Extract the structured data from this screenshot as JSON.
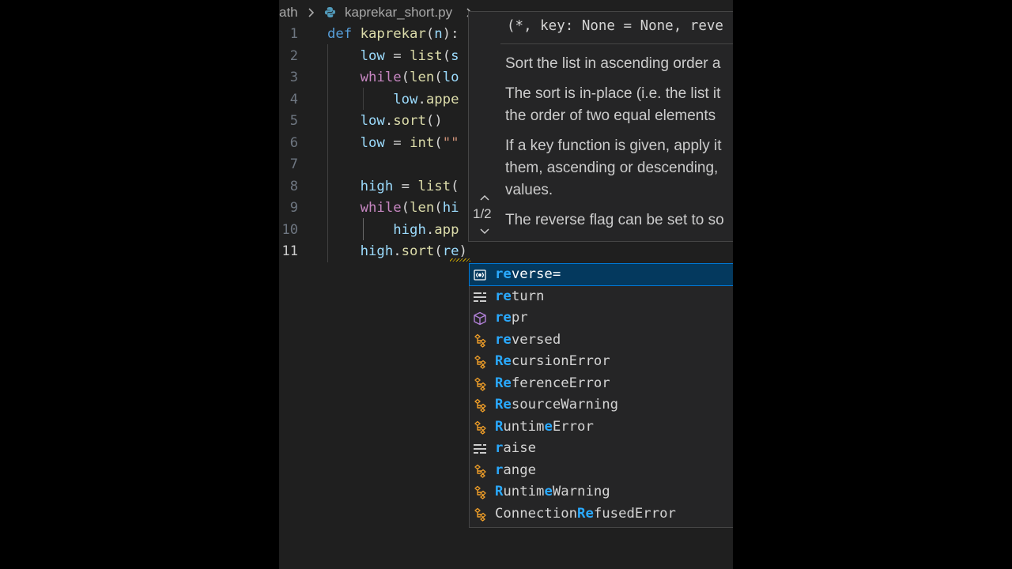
{
  "breadcrumb": {
    "folder": "ath",
    "file": "kaprekar_short.py"
  },
  "code_lines": [
    {
      "num": "1",
      "indent": "",
      "parts": [
        [
          "kw-def",
          "def "
        ],
        [
          "fn",
          "kaprekar"
        ],
        [
          "tx",
          "("
        ],
        [
          "var",
          "n"
        ],
        [
          "tx",
          "):"
        ]
      ]
    },
    {
      "num": "2",
      "indent": "    ",
      "parts": [
        [
          "var",
          "low"
        ],
        [
          "tx",
          " = "
        ],
        [
          "fn",
          "list"
        ],
        [
          "tx",
          "("
        ],
        [
          "var",
          "s"
        ]
      ]
    },
    {
      "num": "3",
      "indent": "    ",
      "parts": [
        [
          "kw-ctrl",
          "while"
        ],
        [
          "tx",
          "("
        ],
        [
          "fn",
          "len"
        ],
        [
          "tx",
          "("
        ],
        [
          "var",
          "lo"
        ]
      ]
    },
    {
      "num": "4",
      "indent": "        ",
      "parts": [
        [
          "var",
          "low"
        ],
        [
          "tx",
          "."
        ],
        [
          "fn",
          "appe"
        ]
      ]
    },
    {
      "num": "5",
      "indent": "    ",
      "parts": [
        [
          "var",
          "low"
        ],
        [
          "tx",
          "."
        ],
        [
          "fn",
          "sort"
        ],
        [
          "tx",
          "()"
        ]
      ]
    },
    {
      "num": "6",
      "indent": "    ",
      "parts": [
        [
          "var",
          "low"
        ],
        [
          "tx",
          " = "
        ],
        [
          "fn",
          "int"
        ],
        [
          "tx",
          "("
        ],
        [
          "str",
          "\"\""
        ]
      ]
    },
    {
      "num": "7",
      "indent": "",
      "parts": []
    },
    {
      "num": "8",
      "indent": "    ",
      "parts": [
        [
          "var",
          "high"
        ],
        [
          "tx",
          " = "
        ],
        [
          "fn",
          "list"
        ],
        [
          "tx",
          "("
        ]
      ]
    },
    {
      "num": "9",
      "indent": "    ",
      "parts": [
        [
          "kw-ctrl",
          "while"
        ],
        [
          "tx",
          "("
        ],
        [
          "fn",
          "len"
        ],
        [
          "tx",
          "("
        ],
        [
          "var",
          "hi"
        ]
      ]
    },
    {
      "num": "10",
      "indent": "        ",
      "parts": [
        [
          "var",
          "high"
        ],
        [
          "tx",
          "."
        ],
        [
          "fn",
          "app"
        ]
      ]
    },
    {
      "num": "11",
      "indent": "    ",
      "parts": [
        [
          "var",
          "high"
        ],
        [
          "tx",
          "."
        ],
        [
          "fn",
          "sort"
        ],
        [
          "tx",
          "("
        ],
        [
          "var",
          "re"
        ],
        [
          "tx",
          ")"
        ]
      ]
    }
  ],
  "signature": {
    "counter": "1/2",
    "text": "(*, key: None = None, reve",
    "doc": [
      [
        "Sort the list in ascending order a"
      ],
      [
        "The sort is in-place (i.e. the list it",
        "the order of two equal elements"
      ],
      [
        "If a key function is given, apply it",
        "them, ascending or descending,",
        "values."
      ],
      [
        "The reverse flag can be set to so"
      ]
    ]
  },
  "suggestions": [
    {
      "label": "reverse=",
      "match": "re",
      "kind": "param",
      "selected": true
    },
    {
      "label": "return",
      "match": "re",
      "kind": "keyword"
    },
    {
      "label": "repr",
      "match": "re",
      "kind": "function"
    },
    {
      "label": "reversed",
      "match": "re",
      "kind": "class"
    },
    {
      "label": "RecursionError",
      "match": "Re",
      "kind": "class"
    },
    {
      "label": "ReferenceError",
      "match": "Re",
      "kind": "class"
    },
    {
      "label": "ResourceWarning",
      "match": "Re",
      "kind": "class"
    },
    {
      "label": "RuntimeError",
      "match": "R_e",
      "kind": "class"
    },
    {
      "label": "raise",
      "match": "r",
      "kind": "keyword"
    },
    {
      "label": "range",
      "match": "r",
      "kind": "class"
    },
    {
      "label": "RuntimeWarning",
      "match": "R_e",
      "kind": "class"
    },
    {
      "label": "ConnectionRefusedError",
      "match": "Re@10",
      "kind": "class"
    }
  ],
  "colors": {
    "class_icon": "#ee9d28",
    "function_icon": "#b180d7",
    "keyword_icon": "#cccccc",
    "match": "#2aaaff",
    "selected_bg": "#04395e"
  }
}
